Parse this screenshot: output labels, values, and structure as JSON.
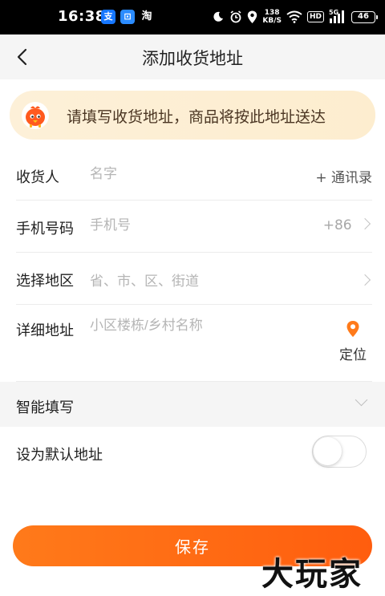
{
  "status_bar": {
    "time": "16:38",
    "app_icons": [
      "支",
      "⊡",
      "淘"
    ],
    "net_speed_value": "138",
    "net_speed_unit": "KB/S",
    "hd": "HD",
    "signal": "5G",
    "battery": "46"
  },
  "nav": {
    "title": "添加收货地址"
  },
  "notice": {
    "text": "请填写收货地址，商品将按此地址送达"
  },
  "form": {
    "recipient": {
      "label": "收货人",
      "placeholder": "名字",
      "action": "+ 通讯录"
    },
    "phone": {
      "label": "手机号码",
      "placeholder": "手机号",
      "code": "+86"
    },
    "region": {
      "label": "选择地区",
      "placeholder": "省、市、区、街道"
    },
    "address": {
      "label": "详细地址",
      "placeholder": "小区楼栋/乡村名称",
      "locate_label": "定位"
    }
  },
  "smart_fill": {
    "label": "智能填写"
  },
  "default_address": {
    "label": "设为默认地址",
    "enabled": false
  },
  "save": {
    "label": "保存"
  },
  "watermark": {
    "text": "大玩家"
  },
  "colors": {
    "accent": "#ff6a13",
    "notice_bg": "#fdf0d8",
    "location_pin": "#ff7a1a"
  }
}
